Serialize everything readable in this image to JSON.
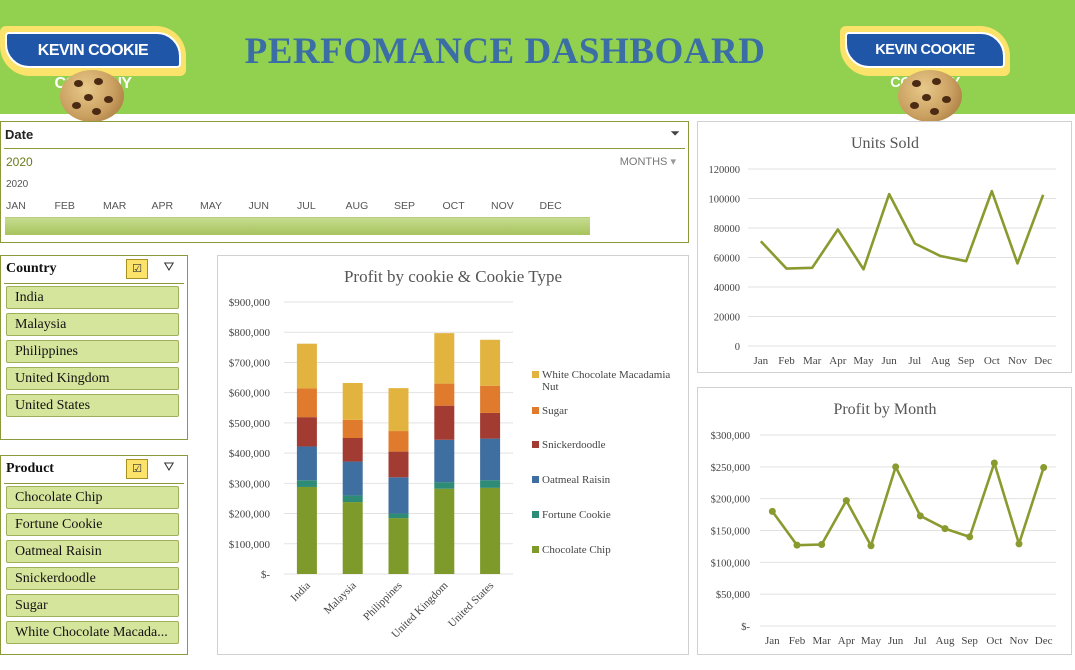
{
  "header": {
    "title": "PERFOMANCE DASHBOARD",
    "logo_text": "KEVIN COOKIE COMPANY"
  },
  "colors": {
    "header_bg": "#92d050",
    "title": "#3a6ea5",
    "series_green": "#8a9a2e"
  },
  "date_slicer": {
    "title": "Date",
    "selected_year": "2020",
    "level": "MONTHS",
    "small_year": "2020",
    "months": [
      "JAN",
      "FEB",
      "MAR",
      "APR",
      "MAY",
      "JUN",
      "JUL",
      "AUG",
      "SEP",
      "OCT",
      "NOV",
      "DEC"
    ]
  },
  "country_slicer": {
    "title": "Country",
    "items": [
      "India",
      "Malaysia",
      "Philippines",
      "United Kingdom",
      "United States"
    ]
  },
  "product_slicer": {
    "title": "Product",
    "items": [
      "Chocolate Chip",
      "Fortune Cookie",
      "Oatmeal Raisin",
      "Snickerdoodle",
      "Sugar",
      "White Chocolate Macada..."
    ]
  },
  "chart_data": [
    {
      "type": "bar",
      "stacked": true,
      "title": "Profit by cookie & Cookie Type",
      "categories": [
        "India",
        "Malaysia",
        "Philippines",
        "United Kingdom",
        "United States"
      ],
      "ylim": [
        0,
        900000
      ],
      "ytick_labels": [
        "$-",
        "$100,000",
        "$200,000",
        "$300,000",
        "$400,000",
        "$500,000",
        "$600,000",
        "$700,000",
        "$800,000",
        "$900,000"
      ],
      "legend_position": "right",
      "series": [
        {
          "name": "Chocolate Chip",
          "color": "#7d9a2b",
          "values": [
            288000,
            238000,
            185000,
            282000,
            285000
          ]
        },
        {
          "name": "Fortune Cookie",
          "color": "#2e8b75",
          "values": [
            22000,
            22000,
            15000,
            22000,
            25000
          ]
        },
        {
          "name": "Oatmeal Raisin",
          "color": "#3f6fa0",
          "values": [
            112000,
            112000,
            120000,
            140000,
            138000
          ]
        },
        {
          "name": "Snickerdoodle",
          "color": "#a23b32",
          "values": [
            97000,
            78000,
            85000,
            113000,
            85000
          ]
        },
        {
          "name": "Sugar",
          "color": "#e07b2d",
          "values": [
            95000,
            60000,
            68000,
            73000,
            90000
          ]
        },
        {
          "name": "White Chocolate Macadamia Nut",
          "color": "#e3b33f",
          "values": [
            148000,
            122000,
            142000,
            167000,
            152000
          ]
        }
      ]
    },
    {
      "type": "line",
      "title": "Units Sold",
      "categories": [
        "Jan",
        "Feb",
        "Mar",
        "Apr",
        "May",
        "Jun",
        "Jul",
        "Aug",
        "Sep",
        "Oct",
        "Nov",
        "Dec"
      ],
      "ylim": [
        0,
        120000
      ],
      "ytick_labels": [
        "0",
        "20000",
        "40000",
        "60000",
        "80000",
        "100000",
        "120000"
      ],
      "series": [
        {
          "color": "#8a9a2e",
          "values": [
            71000,
            52500,
            53000,
            79000,
            52000,
            103000,
            69500,
            61000,
            57500,
            105000,
            56000,
            102500
          ]
        }
      ]
    },
    {
      "type": "line",
      "title": "Profit by Month",
      "categories": [
        "Jan",
        "Feb",
        "Mar",
        "Apr",
        "May",
        "Jun",
        "Jul",
        "Aug",
        "Sep",
        "Oct",
        "Nov",
        "Dec"
      ],
      "ylim": [
        0,
        300000
      ],
      "ytick_labels": [
        "$-",
        "$50,000",
        "$100,000",
        "$150,000",
        "$200,000",
        "$250,000",
        "$300,000"
      ],
      "markers": true,
      "series": [
        {
          "color": "#8a9a2e",
          "values": [
            180000,
            127000,
            128000,
            197000,
            126000,
            250000,
            173000,
            153000,
            140000,
            256000,
            129000,
            249000
          ]
        }
      ]
    }
  ]
}
